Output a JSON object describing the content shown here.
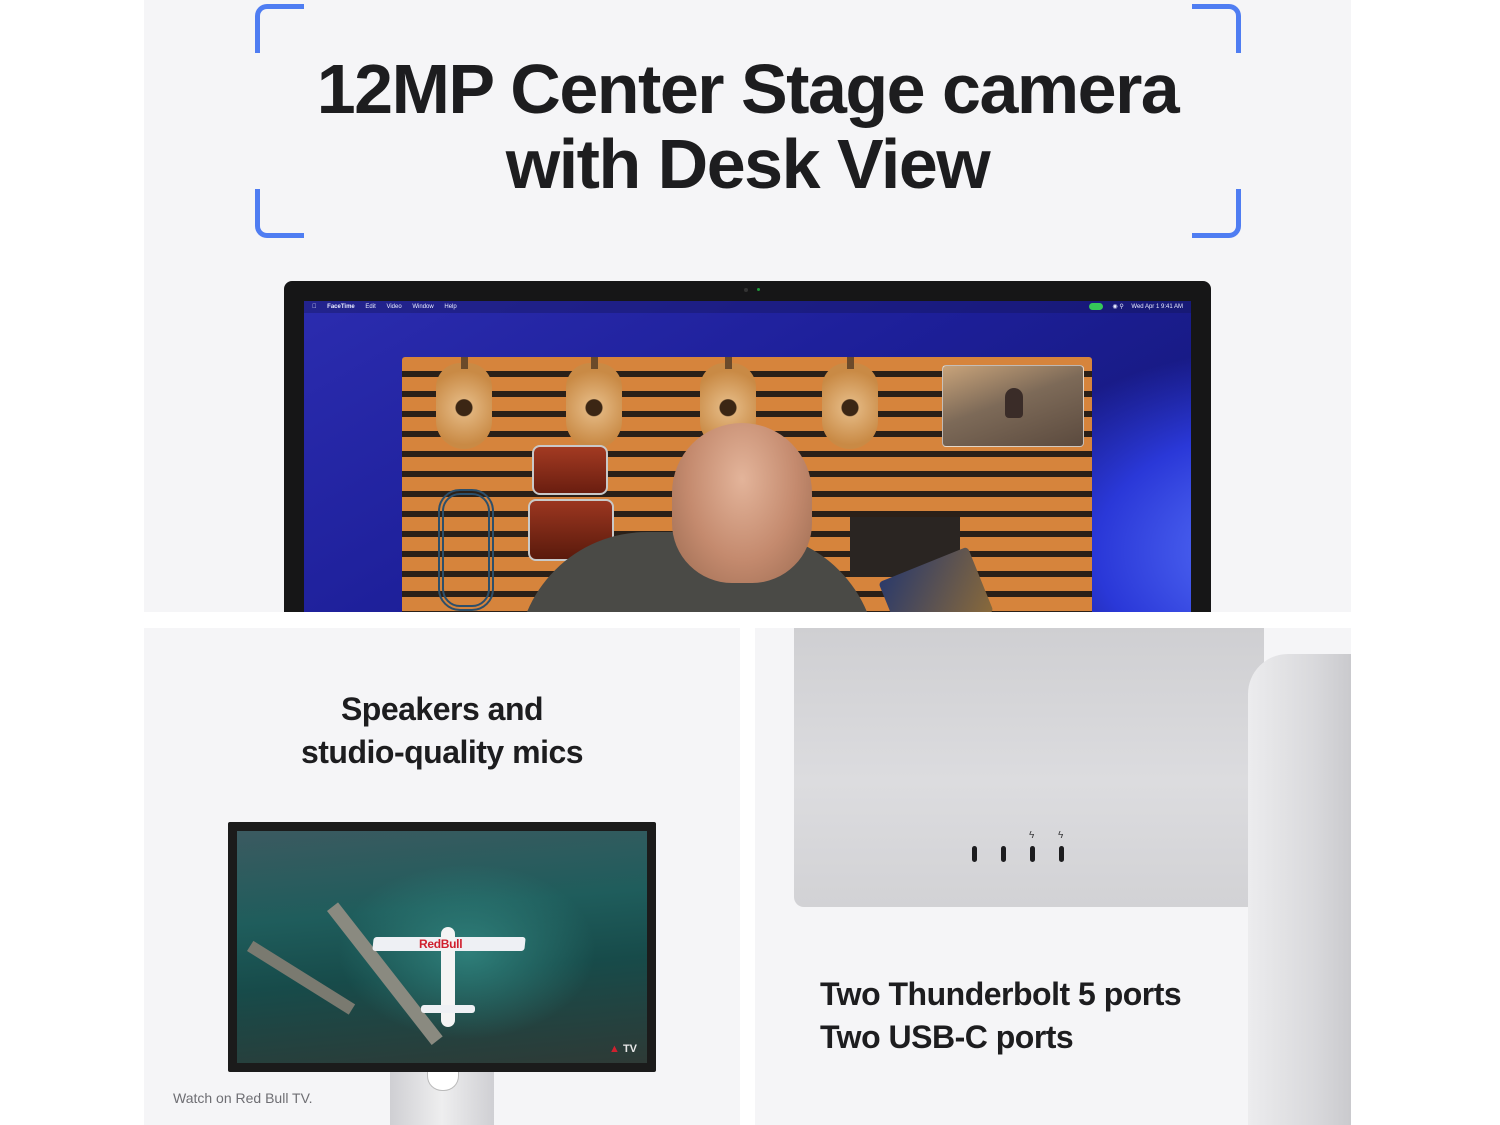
{
  "hero": {
    "title_line1": "12MP Center Stage camera",
    "title_line2": "with Desk View",
    "bracket_color": "#4f7df2"
  },
  "facetime": {
    "menu_items": [
      "",
      "FaceTime",
      "Edit",
      "Video",
      "Window",
      "Help"
    ],
    "clock": "Wed Apr 1 9:41 AM"
  },
  "speakers": {
    "title_line1": "Speakers and",
    "title_line2": "studio-quality mics",
    "wing_text": "RedBull",
    "tv_logo_text": "TV",
    "caption": "Watch on Red Bull TV."
  },
  "ports": {
    "line1": "Two Thunderbolt 5 ports",
    "line2": "Two USB-C ports",
    "thunderbolt_icon": "ϟ"
  },
  "colors": {
    "panel_background": "#f5f5f7",
    "text": "#1d1d1f",
    "caption": "#6e6e73",
    "accent": "#4f7df2"
  }
}
